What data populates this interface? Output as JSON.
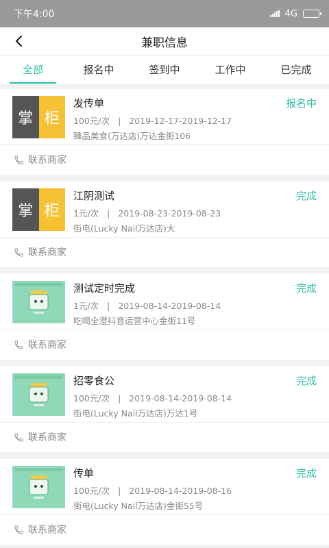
{
  "status_bar": {
    "time": "下午4:00",
    "network": "4G"
  },
  "header": {
    "title": "兼职信息"
  },
  "tabs": [
    {
      "label": "全部",
      "active": true
    },
    {
      "label": "报名中"
    },
    {
      "label": "签到中"
    },
    {
      "label": "工作中"
    },
    {
      "label": "已完成"
    }
  ],
  "colors": {
    "accent": "#2bbfa8",
    "logo_dark": "#555555",
    "logo_yellow": "#f6c132",
    "mint": "#8fd9b8"
  },
  "jobs": [
    {
      "title": "发传单",
      "status": "报名中",
      "price": "100元/次",
      "dates": "2019-12-17-2019-12-17",
      "address": "臻品美食(万达店)万达金街106",
      "contact": "联系商家",
      "thumb": "logo",
      "logo_left": "掌",
      "logo_right": "柜"
    },
    {
      "title": "江阴测试",
      "status": "完成",
      "price": "1元/次",
      "dates": "2019-08-23-2019-08-23",
      "address": "街电(Lucky Nail万达店)大",
      "contact": "联系商家",
      "thumb": "logo",
      "logo_left": "掌",
      "logo_right": "柜"
    },
    {
      "title": "测试定时完成",
      "status": "完成",
      "price": "1元/次",
      "dates": "2019-08-14-2019-08-14",
      "address": "吃喝全澄抖音运营中心金街11号",
      "contact": "联系商家",
      "thumb": "mint"
    },
    {
      "title": "招零食公",
      "status": "完成",
      "price": "100元/次",
      "dates": "2019-08-14-2019-08-14",
      "address": "街电(Lucky Nail万达店)万达1号",
      "contact": "联系商家",
      "thumb": "mint"
    },
    {
      "title": "传单",
      "status": "完成",
      "price": "100元/次",
      "dates": "2019-08-14-2019-08-16",
      "address": "街电(Lucky Nail万达店)金街55号",
      "contact": "联系商家",
      "thumb": "mint"
    }
  ]
}
